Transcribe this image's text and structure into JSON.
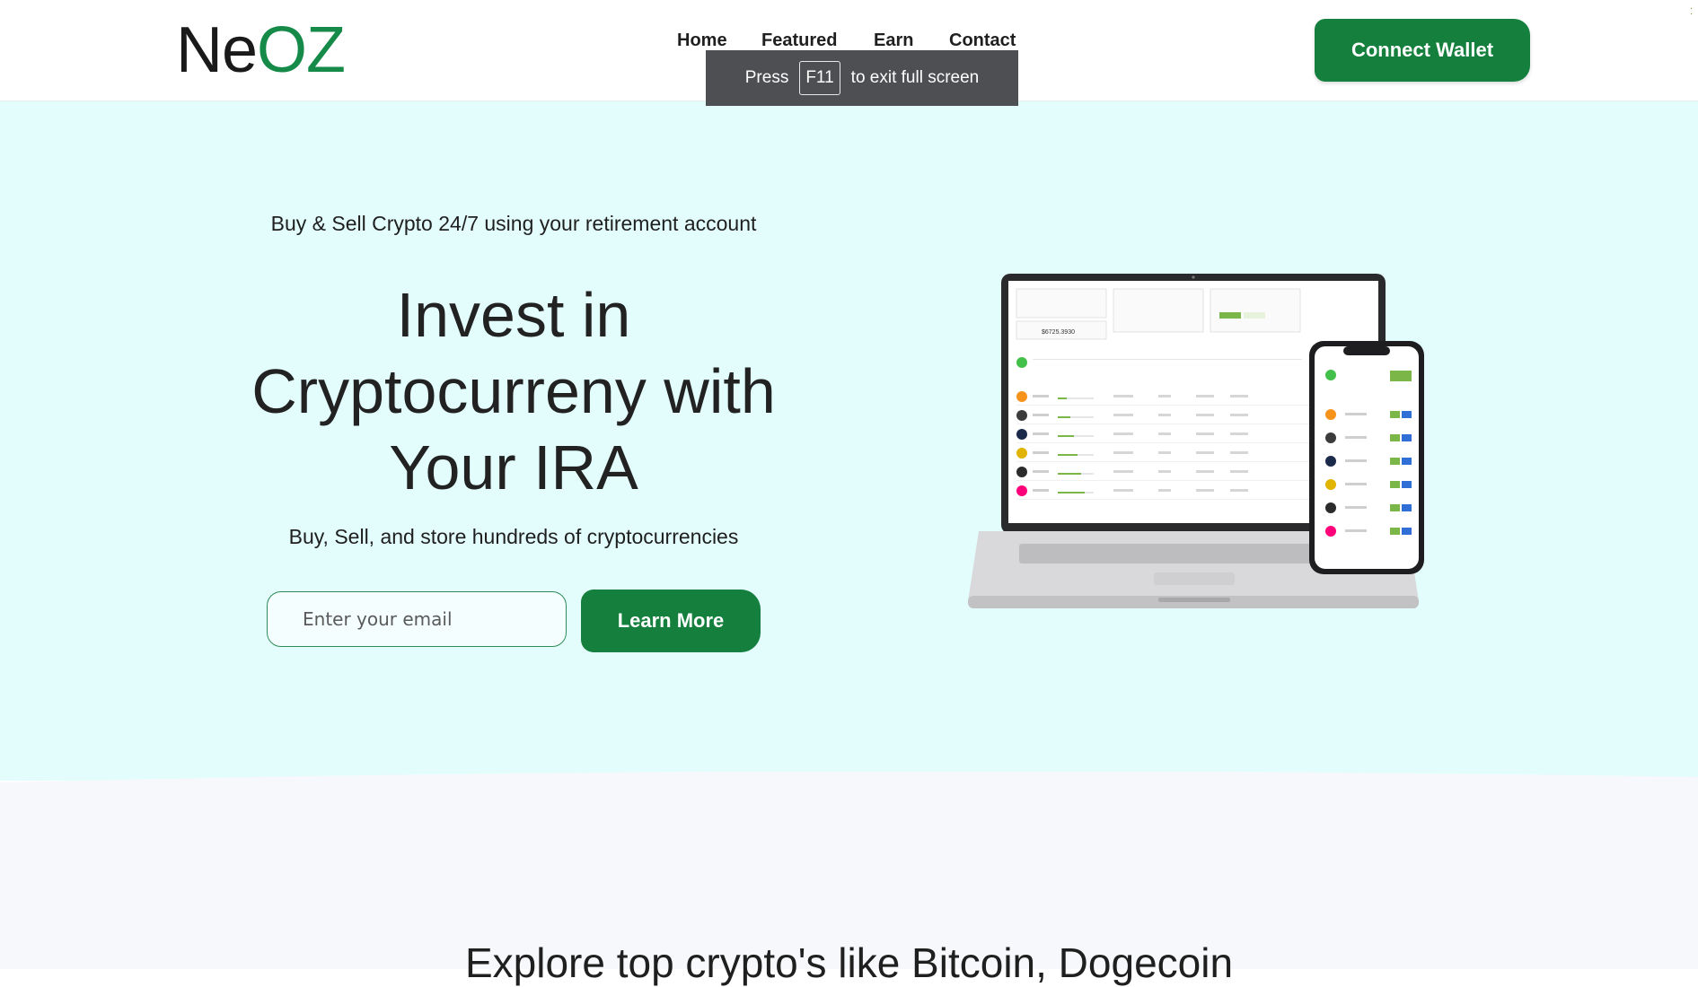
{
  "brand": {
    "logo_part1": "Ne",
    "logo_part2": "OZ"
  },
  "nav": {
    "items": [
      "Home",
      "Featured",
      "Earn",
      "Contact"
    ]
  },
  "header": {
    "connect_label": "Connect Wallet"
  },
  "fullscreen_notice": {
    "press": "Press",
    "key": "F11",
    "rest": "to exit full screen"
  },
  "hero": {
    "tagline": "Buy & Sell Crypto 24/7 using your retirement account",
    "headline_line1": "Invest in",
    "headline_line2": "Cryptocurreny with",
    "headline_line3": "Your IRA",
    "subheadline": "Buy, Sell, and store hundreds of cryptocurrencies",
    "email_placeholder": "Enter your email",
    "cta_label": "Learn More"
  },
  "device_mockup": {
    "portfolio_value": "$6725.3930",
    "coin_colors": [
      "#f7931a",
      "#3c3c3d",
      "#1b2a4a",
      "#e1b303",
      "#2b2b2b",
      "#ff007a"
    ]
  },
  "section2": {
    "heading": "Explore top crypto's like Bitcoin, Dogecoin"
  }
}
